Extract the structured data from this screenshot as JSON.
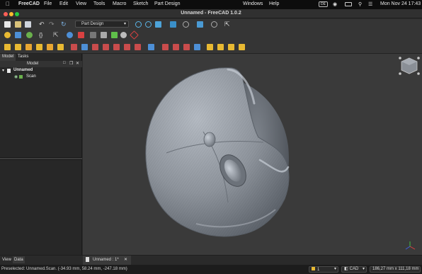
{
  "menubar": {
    "app_name": "FreeCAD",
    "items": [
      "File",
      "Edit",
      "View",
      "Tools",
      "Macro",
      "Sketch",
      "Part Design",
      "Windows",
      "Help"
    ],
    "language_badge": "DE",
    "datetime": "Mon Nov 24  17:43"
  },
  "window": {
    "title": "Unnamed - FreeCAD 1.0.2"
  },
  "toolbar": {
    "workbench": "Part Design",
    "braces": "{}"
  },
  "combo_view": {
    "tabs": [
      "Model",
      "Tasks"
    ],
    "tree_header": "Model",
    "tree": [
      {
        "label": "Unnamed",
        "level": 0
      },
      {
        "label": "Scan",
        "level": 1
      }
    ]
  },
  "bottom_tabs": {
    "view": "View",
    "data": "Data",
    "document_tab": "Unnamed : 1*"
  },
  "statusbar": {
    "message": "Preselected: Unnamed.Scan. (-34.93 mm, 58.24 mm, -247.18 mm)",
    "selection_count": "1",
    "navigation": "CAD",
    "dimensions": "186,27 mm x 111,18 mm"
  },
  "colors": {
    "menubar_bg": "#0d0d0d",
    "toolbar_bg": "#353535",
    "viewport_bg": "#3a3a3a",
    "model_gray": "#8a9098",
    "close_red": "#ff5f57",
    "min_yellow": "#febc2e",
    "max_green": "#28c840"
  }
}
